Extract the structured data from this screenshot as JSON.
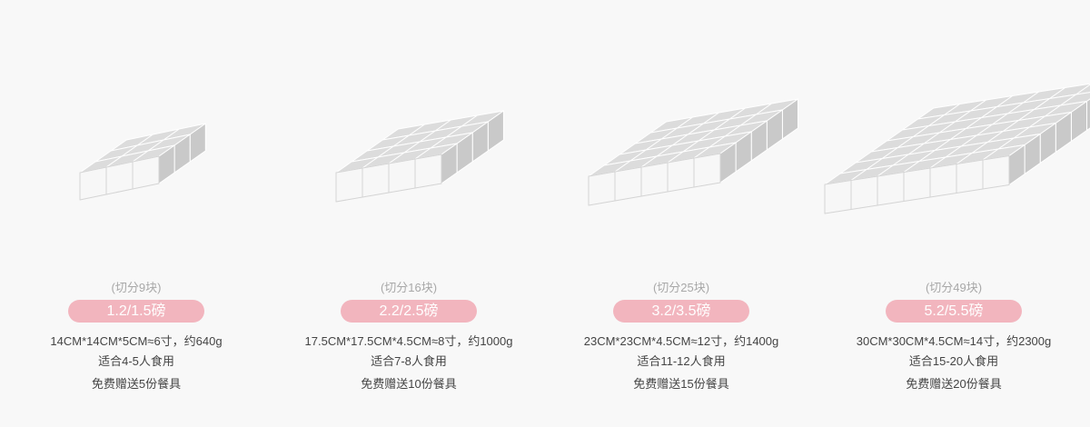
{
  "products": [
    {
      "pieces": "(切分9块)",
      "weight": "1.2/1.5磅",
      "size": "14CM*14CM*5CM≈6寸，约640g",
      "serves": "适合4-5人食用",
      "gift": "免费赠送5份餐具"
    },
    {
      "pieces": "(切分16块)",
      "weight": "2.2/2.5磅",
      "size": "17.5CM*17.5CM*4.5CM≈8寸，约1000g",
      "serves": "适合7-8人食用",
      "gift": "免费赠送10份餐具"
    },
    {
      "pieces": "(切分25块)",
      "weight": "3.2/3.5磅",
      "size": "23CM*23CM*4.5CM≈12寸，约1400g",
      "serves": "适合11-12人食用",
      "gift": "免费赠送15份餐具"
    },
    {
      "pieces": "(切分49块)",
      "weight": "5.2/5.5磅",
      "size": "30CM*30CM*4.5CM≈14寸，约2300g",
      "serves": "适合15-20人食用",
      "gift": "免费赠送20份餐具"
    }
  ],
  "colors": {
    "badge": "#f2b5be",
    "cube_top": "#dcdcdc",
    "cube_front": "#f7f7f7",
    "cube_side": "#c9c9c9"
  }
}
